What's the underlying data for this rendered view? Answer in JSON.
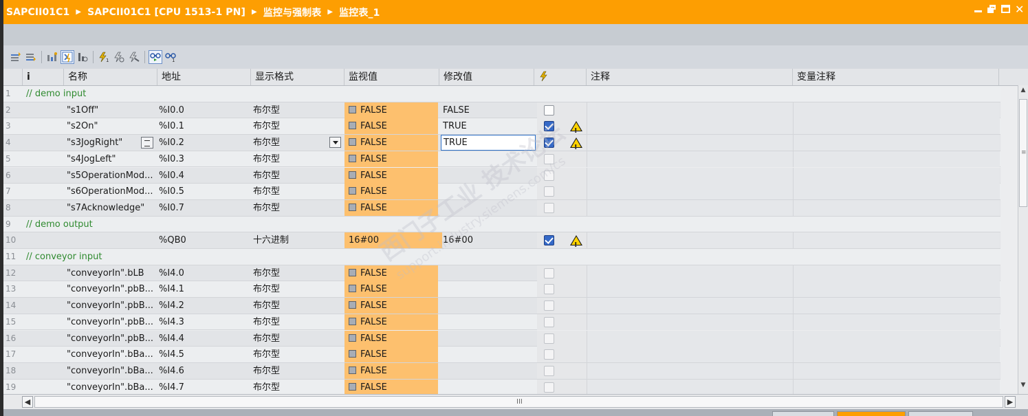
{
  "title": {
    "crumbs": [
      "SAPCII01C1",
      "SAPCII01C1 [CPU 1513-1 PN]",
      "监控与强制表",
      "监控表_1"
    ]
  },
  "table": {
    "headers": {
      "info": "i",
      "name": "名称",
      "address": "地址",
      "format": "显示格式",
      "monitor": "监视值",
      "modify": "修改值",
      "comment": "注释",
      "var_comment": "变量注释"
    },
    "rows": [
      {
        "num": "1",
        "type": "comment",
        "text": "// demo input"
      },
      {
        "num": "2",
        "name": "\"s1Off\"",
        "addr": "%I0.0",
        "fmt": "布尔型",
        "mon": "FALSE",
        "mod": "FALSE",
        "chk": "off",
        "warn": false
      },
      {
        "num": "3",
        "name": "\"s2On\"",
        "addr": "%I0.1",
        "fmt": "布尔型",
        "mon": "FALSE",
        "mod": "TRUE",
        "chk": "on",
        "warn": true
      },
      {
        "num": "4",
        "name": "\"s3JogRight\"",
        "addr": "%I0.2",
        "fmt": "布尔型",
        "mon": "FALSE",
        "mod": "TRUE",
        "chk": "on",
        "warn": true,
        "selected": true
      },
      {
        "num": "5",
        "name": "\"s4JogLeft\"",
        "addr": "%I0.3",
        "fmt": "布尔型",
        "mon": "FALSE",
        "mod": "",
        "chk": "dis",
        "warn": false
      },
      {
        "num": "6",
        "name": "\"s5OperationMod...",
        "addr": "%I0.4",
        "fmt": "布尔型",
        "mon": "FALSE",
        "mod": "",
        "chk": "dis",
        "warn": false
      },
      {
        "num": "7",
        "name": "\"s6OperationMod...",
        "addr": "%I0.5",
        "fmt": "布尔型",
        "mon": "FALSE",
        "mod": "",
        "chk": "dis",
        "warn": false
      },
      {
        "num": "8",
        "name": "\"s7Acknowledge\"",
        "addr": "%I0.7",
        "fmt": "布尔型",
        "mon": "FALSE",
        "mod": "",
        "chk": "dis",
        "warn": false
      },
      {
        "num": "9",
        "type": "comment",
        "text": "// demo output"
      },
      {
        "num": "10",
        "name": "",
        "addr": "%QB0",
        "fmt": "十六进制",
        "mon": "16#00",
        "mod": "16#00",
        "chk": "on",
        "warn": true,
        "hex": true
      },
      {
        "num": "11",
        "type": "comment",
        "text": "// conveyor input"
      },
      {
        "num": "12",
        "name": "\"conveyorIn\".bLB",
        "addr": "%I4.0",
        "fmt": "布尔型",
        "mon": "FALSE",
        "mod": "",
        "chk": "dis",
        "warn": false
      },
      {
        "num": "13",
        "name": "\"conveyorIn\".pbB...",
        "addr": "%I4.1",
        "fmt": "布尔型",
        "mon": "FALSE",
        "mod": "",
        "chk": "dis",
        "warn": false
      },
      {
        "num": "14",
        "name": "\"conveyorIn\".pbB...",
        "addr": "%I4.2",
        "fmt": "布尔型",
        "mon": "FALSE",
        "mod": "",
        "chk": "dis",
        "warn": false
      },
      {
        "num": "15",
        "name": "\"conveyorIn\".pbB...",
        "addr": "%I4.3",
        "fmt": "布尔型",
        "mon": "FALSE",
        "mod": "",
        "chk": "dis",
        "warn": false
      },
      {
        "num": "16",
        "name": "\"conveyorIn\".pbB...",
        "addr": "%I4.4",
        "fmt": "布尔型",
        "mon": "FALSE",
        "mod": "",
        "chk": "dis",
        "warn": false
      },
      {
        "num": "17",
        "name": "\"conveyorIn\".bBa...",
        "addr": "%I4.5",
        "fmt": "布尔型",
        "mon": "FALSE",
        "mod": "",
        "chk": "dis",
        "warn": false
      },
      {
        "num": "18",
        "name": "\"conveyorIn\".bBa...",
        "addr": "%I4.6",
        "fmt": "布尔型",
        "mon": "FALSE",
        "mod": "",
        "chk": "dis",
        "warn": false
      },
      {
        "num": "19",
        "name": "\"conveyorIn\".bBa...",
        "addr": "%I4.7",
        "fmt": "布尔型",
        "mon": "FALSE",
        "mod": "",
        "chk": "dis",
        "warn": false
      }
    ]
  },
  "watermark": {
    "line1": "西门子工业 技术论坛",
    "line2": "support.industry.siemens.com/cs"
  },
  "colors": {
    "titlebar": "#fd9e02",
    "monitor_cell": "#fdc06e",
    "comment_text": "#2f8a2f",
    "checkbox_on": "#3569c7"
  },
  "icons": {
    "toolbar": [
      "insert-row-icon",
      "add-row-icon",
      "insert-comment-icon",
      "show-all-columns-icon",
      "extended-mode-icon",
      "modify-now-icon",
      "modify-with-trigger-icon",
      "enable-peripheral-outputs-icon",
      "monitor-all-icon",
      "monitor-now-icon"
    ]
  }
}
